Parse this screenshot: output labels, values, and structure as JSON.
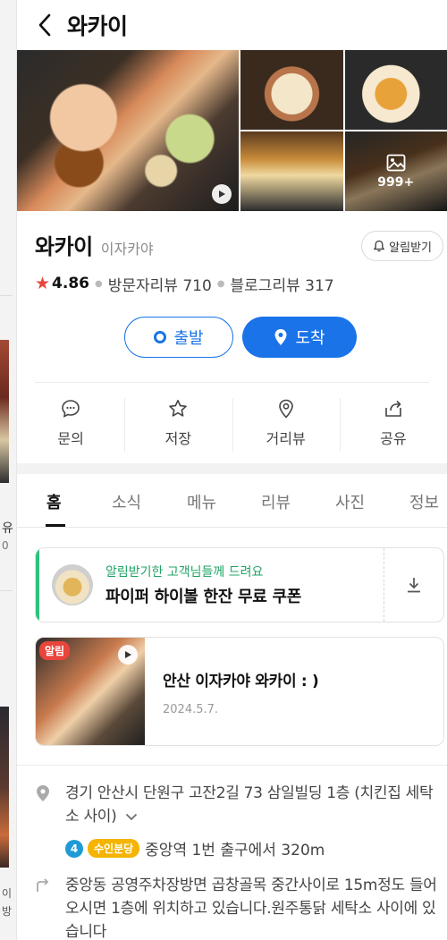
{
  "header": {
    "title": "와카이"
  },
  "photos": {
    "more_count": "999+"
  },
  "place": {
    "name": "와카이",
    "category": "이자카야",
    "notify_label": "알림받기",
    "rating": "4.86",
    "visitor_reviews": "방문자리뷰 710",
    "blog_reviews": "블로그리뷰 317"
  },
  "route": {
    "departure": "출발",
    "arrival": "도착"
  },
  "actions": [
    {
      "label": "문의"
    },
    {
      "label": "저장"
    },
    {
      "label": "거리뷰"
    },
    {
      "label": "공유"
    }
  ],
  "tabs": [
    {
      "label": "홈"
    },
    {
      "label": "소식"
    },
    {
      "label": "메뉴"
    },
    {
      "label": "리뷰"
    },
    {
      "label": "사진"
    },
    {
      "label": "정보"
    }
  ],
  "coupon": {
    "subtitle": "알림받기한 고객님들께 드려요",
    "title": "파이퍼 하이볼 한잔 무료 쿠폰"
  },
  "news": {
    "badge": "알림",
    "title": "안산 이자카야 와카이 : )",
    "date": "2024.5.7."
  },
  "info": {
    "address": "경기 안산시 단원구 고잔2길 73 삼일빌딩 1층 (치킨집 세탁소 사이)",
    "subway_line_number": "4",
    "subway_line_name": "수인분당",
    "subway_text": "중앙역 1번 출구에서 320m",
    "directions": "중앙동 공영주차장방면 곱창골목 중간사이로 15m정도 들어오시면 1층에 위치하고 있습니다.원주통닭 세탁소 사이에 있습니다"
  },
  "background": {
    "peek_1": "유",
    "peek_2": "0",
    "peek_3": "이",
    "peek_4": "방"
  },
  "colors": {
    "accent": "#1a73e8",
    "star": "#e8453c",
    "coupon_green": "#2ec27e",
    "subway_line4": "#1e9bd7",
    "subway_suin": "#f4b400"
  }
}
